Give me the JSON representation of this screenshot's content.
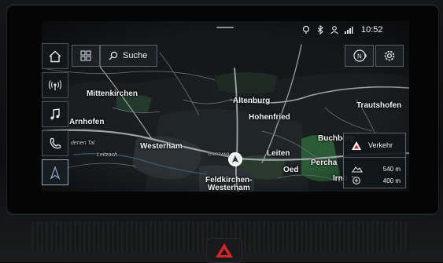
{
  "status": {
    "time": "10:52",
    "icons": [
      "navigation-status-icon",
      "bluetooth-icon",
      "user-profile-icon",
      "signal-icon"
    ]
  },
  "left_nav": [
    {
      "name": "home-icon"
    },
    {
      "name": "radio-icon"
    },
    {
      "name": "music-icon"
    },
    {
      "name": "phone-icon"
    },
    {
      "name": "navigation-icon",
      "active": true
    }
  ],
  "top_bar": {
    "menu_icon": "grid-menu-icon",
    "search_label": "Suche",
    "compass_label": "N",
    "settings_icon": "gear-icon"
  },
  "map": {
    "places": {
      "mittenkirchen": "Mittenkirchen",
      "altenburg": "Altenburg",
      "trautshofen": "Trautshofen",
      "hohenfried": "Hohenfried",
      "arnhofen": "Arnhofen",
      "denen_tal": "denen Tal",
      "westerham": "Westerham",
      "buchberg": "Buchberg",
      "leitzach": "Leitzach",
      "grenzweg": "Grenzweg",
      "leiten": "Leiten",
      "perchal": "Percha",
      "oed": "Oed",
      "irnberg": "Irnb",
      "feldkirchen_1": "Feldkirchen-",
      "feldkirchen_2": "Westerham"
    }
  },
  "traffic_panel": {
    "label": "Verkehr",
    "elevation": "540 m",
    "zoom": "400 m"
  },
  "colors": {
    "accent": "#8da7b8",
    "panel_border": "#596570",
    "hazard": "#d2262a",
    "forest": "#2b5a36"
  }
}
